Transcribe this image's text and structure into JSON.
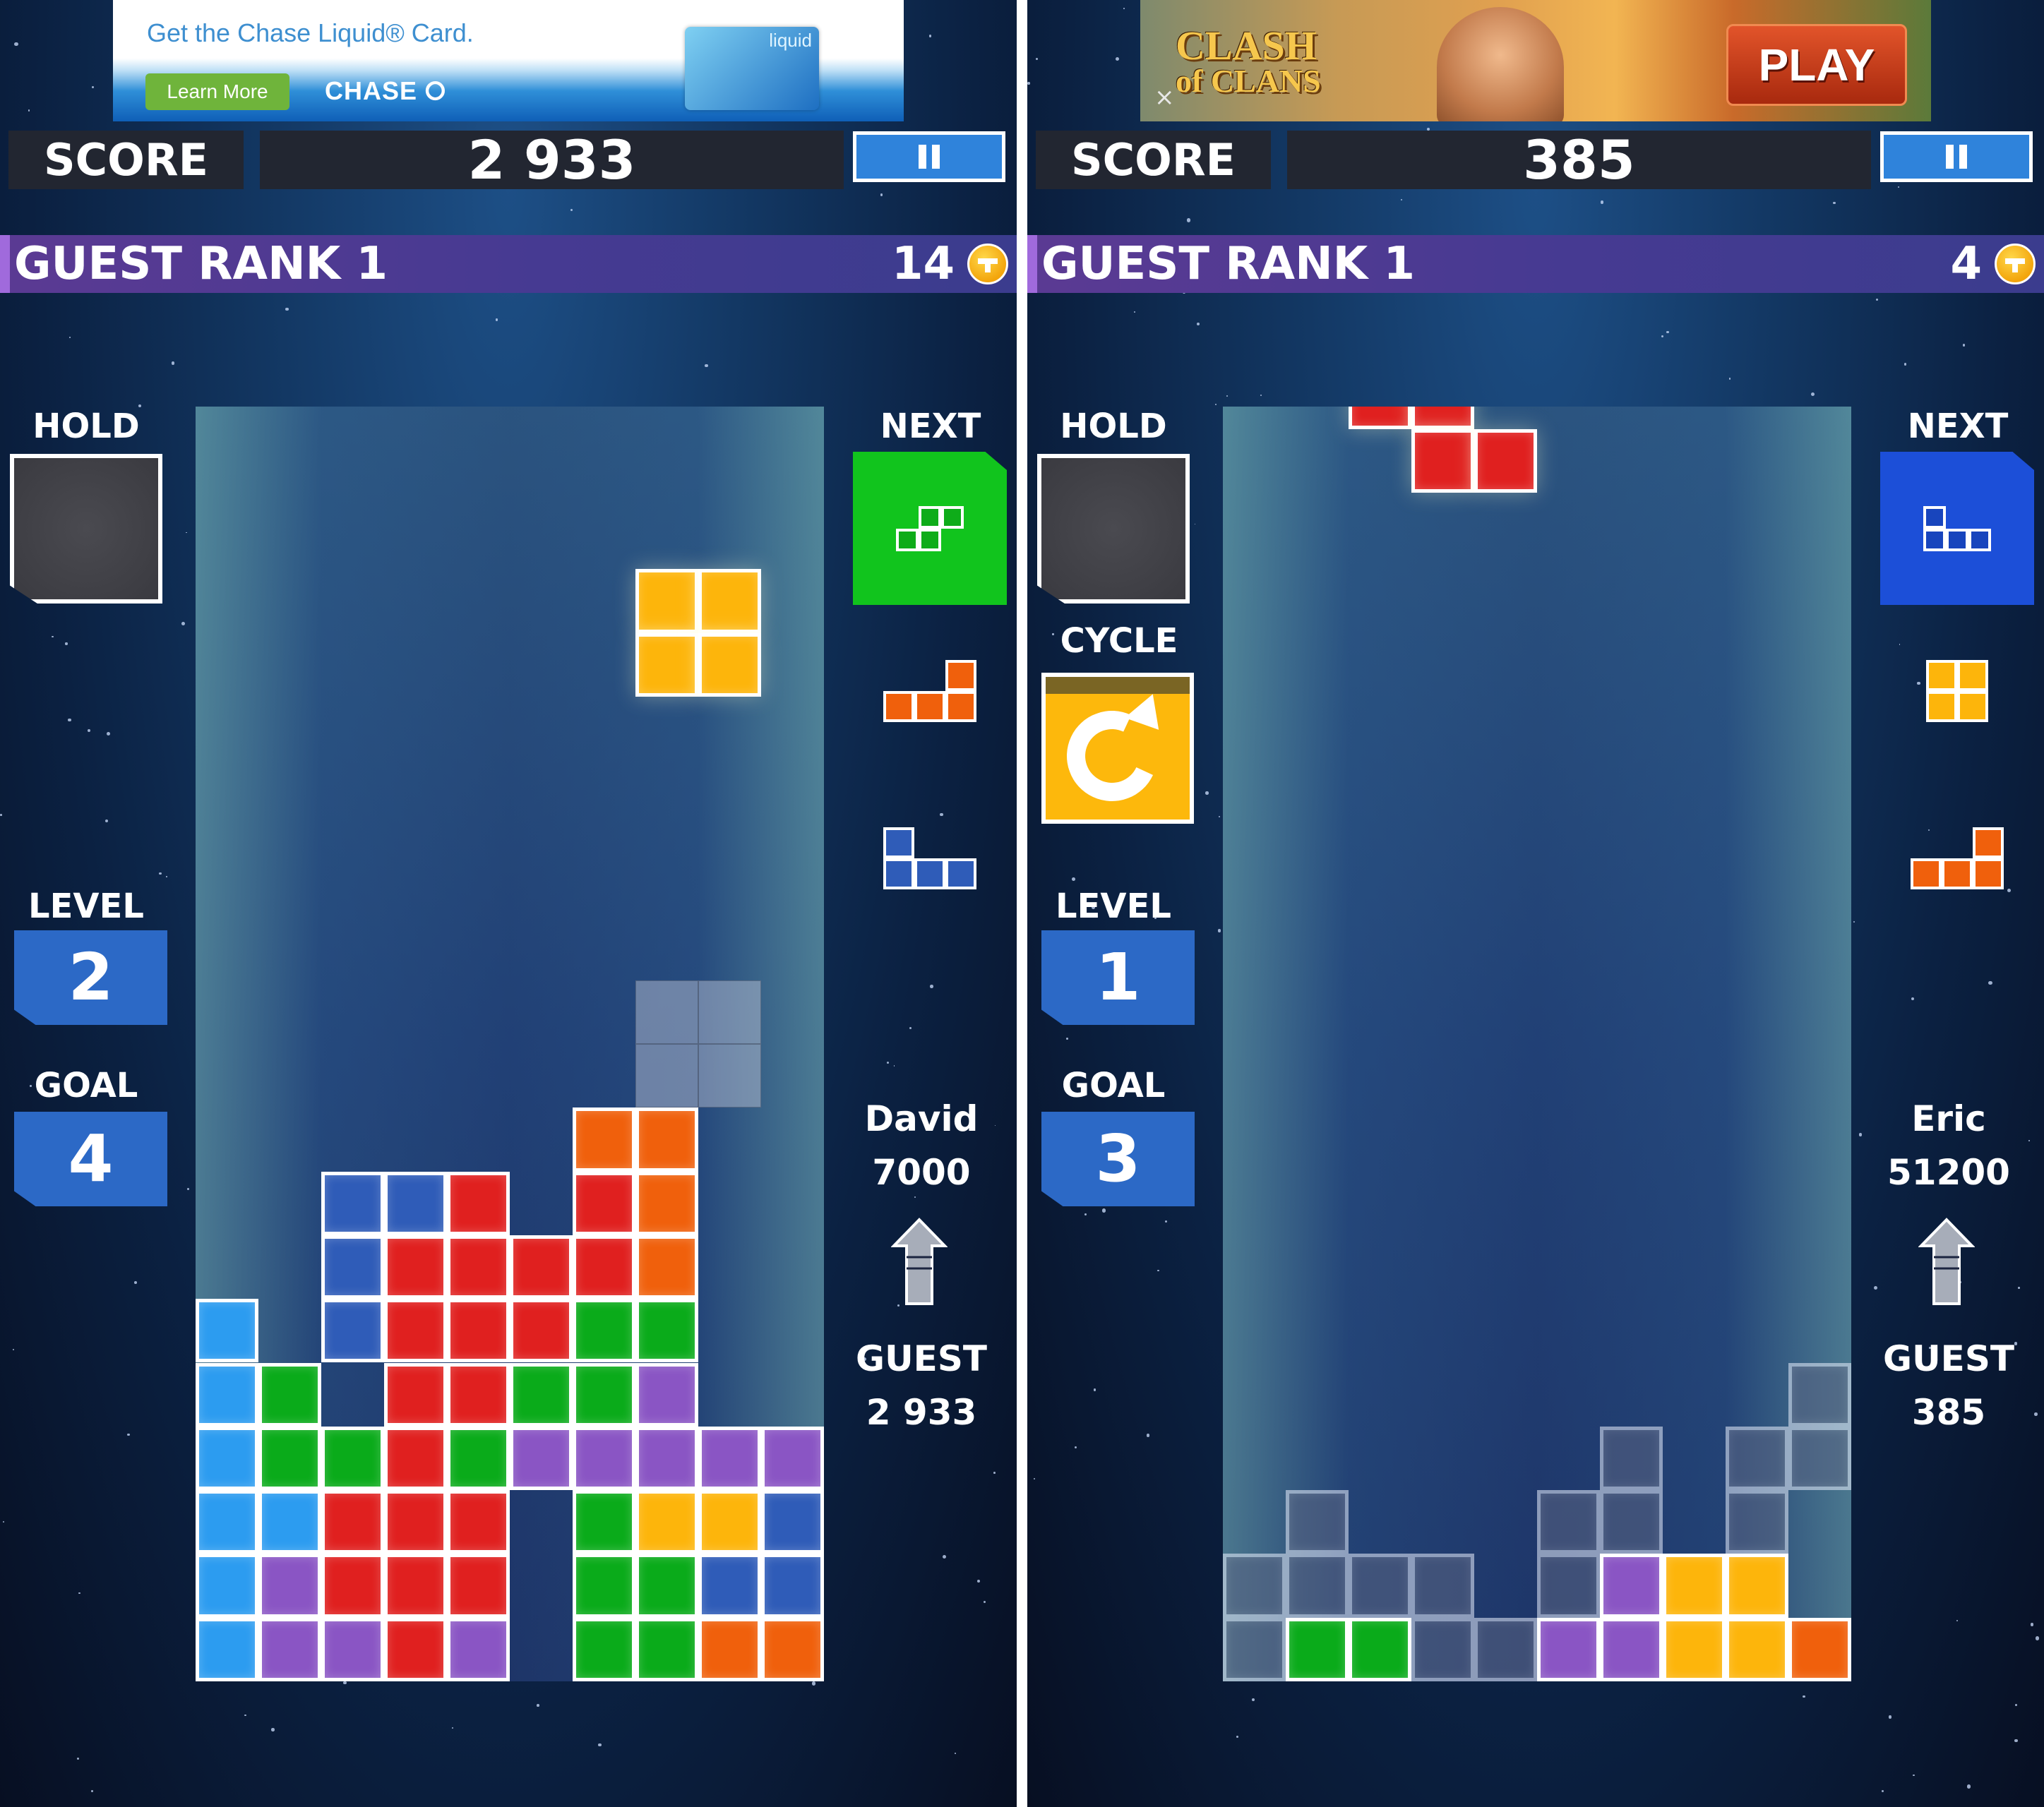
{
  "colors": {
    "I": "#2c9cf0",
    "O": "#fdb50b",
    "T": "#8a55c4",
    "S": "#0aab1a",
    "Z": "#e0201f",
    "J": "#2f5cb8",
    "L": "#f0600c",
    "G": "#5a6482",
    "accent_blue": "#2c69c6",
    "rank_bar": "#473a92"
  },
  "panels": [
    {
      "id": "left",
      "ad": {
        "type": "chase",
        "headline": "Get the Chase Liquid® Card.",
        "button": "Learn More",
        "brand": "CHASE ⭘",
        "card_text": "liquid"
      },
      "score": {
        "label": "SCORE",
        "value": "2 933"
      },
      "pause_label": "pause",
      "rank": {
        "label": "GUEST RANK 1",
        "coins": "14"
      },
      "hold": {
        "label": "HOLD",
        "piece": null
      },
      "cycle": null,
      "next": {
        "label": "NEXT",
        "pieces": [
          "S",
          "L",
          "J"
        ]
      },
      "level": {
        "label": "LEVEL",
        "value": "2"
      },
      "goal": {
        "label": "GOAL",
        "value": "4"
      },
      "rival": {
        "name": "David",
        "score": "7000"
      },
      "player": {
        "name": "GUEST",
        "score": "2 933"
      },
      "active_piece": {
        "type": "O",
        "cells": [
          [
            7,
            2
          ],
          [
            8,
            2
          ],
          [
            7,
            3
          ],
          [
            8,
            3
          ]
        ],
        "offset_rows": 0.55
      },
      "ghost_cells": [
        [
          7,
          9
        ],
        [
          8,
          9
        ],
        [
          7,
          10
        ],
        [
          8,
          10
        ]
      ],
      "board": [
        "..........",
        "..........",
        "..........",
        "..........",
        "..........",
        "..........",
        "..........",
        "..........",
        "..........",
        "..........",
        "..........",
        "......LL..",
        "..JJZ.ZL..",
        "..JZZZZL..",
        "I.JZZZSS..",
        "IS.ZZSST..",
        "ISSZSTTTTT",
        "IIZZZ.SOOJ",
        "ITZZZ.SSJJ",
        "ITTZT.SSLL"
      ]
    },
    {
      "id": "right",
      "ad": {
        "type": "coc",
        "title_line1": "CLASH",
        "title_line2": "of CLANS",
        "button": "PLAY",
        "close": "×"
      },
      "score": {
        "label": "SCORE",
        "value": "385"
      },
      "pause_label": "pause",
      "rank": {
        "label": "GUEST RANK 1",
        "coins": "4"
      },
      "hold": {
        "label": "HOLD",
        "piece": null
      },
      "cycle": {
        "label": "CYCLE"
      },
      "next": {
        "label": "NEXT",
        "pieces": [
          "J",
          "O",
          "L"
        ]
      },
      "level": {
        "label": "LEVEL",
        "value": "1"
      },
      "goal": {
        "label": "GOAL",
        "value": "3"
      },
      "rival": {
        "name": "Eric",
        "score": "51200"
      },
      "player": {
        "name": "GUEST",
        "score": "385"
      },
      "active_piece": {
        "type": "Z",
        "cells": [
          [
            2,
            -1
          ],
          [
            3,
            -1
          ],
          [
            3,
            0
          ],
          [
            4,
            0
          ]
        ],
        "offset_rows": 0.35
      },
      "ghost_cells": [],
      "board": [
        "..........",
        "..........",
        "..........",
        "..........",
        "..........",
        "..........",
        "..........",
        "..........",
        "..........",
        "..........",
        "..........",
        "..........",
        "..........",
        "..........",
        "..........",
        ".........G",
        "......G.GG",
        ".G...GG.G.",
        "GGGG.GTOO.",
        "GSSGGTTOOL"
      ]
    }
  ]
}
